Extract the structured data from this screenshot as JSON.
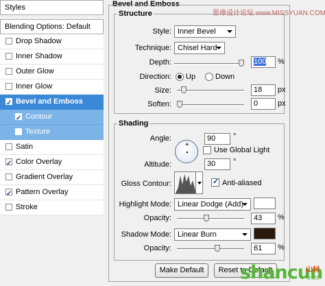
{
  "left_panel": {
    "header": "Styles",
    "blending": "Blending Options: Default",
    "items": [
      {
        "label": "Drop Shadow",
        "checked": false
      },
      {
        "label": "Inner Shadow",
        "checked": false
      },
      {
        "label": "Outer Glow",
        "checked": false
      },
      {
        "label": "Inner Glow",
        "checked": false
      },
      {
        "label": "Bevel and Emboss",
        "checked": true
      },
      {
        "label": "Contour",
        "checked": true
      },
      {
        "label": "Texture",
        "checked": false
      },
      {
        "label": "Satin",
        "checked": false
      },
      {
        "label": "Color Overlay",
        "checked": true
      },
      {
        "label": "Gradient Overlay",
        "checked": false
      },
      {
        "label": "Pattern Overlay",
        "checked": true
      },
      {
        "label": "Stroke",
        "checked": false
      }
    ]
  },
  "bevel": {
    "title": "Bevel and Emboss",
    "structure": {
      "title": "Structure",
      "style_label": "Style:",
      "style_value": "Inner Bevel",
      "technique_label": "Technique:",
      "technique_value": "Chisel Hard",
      "depth_label": "Depth:",
      "depth_value": "100",
      "depth_unit": "%",
      "depth_level": 1.0,
      "direction_label": "Direction:",
      "direction_up": "Up",
      "direction_down": "Down",
      "size_label": "Size:",
      "size_value": "18",
      "size_unit": "px",
      "size_level": 0.07,
      "soften_label": "Soften:",
      "soften_value": "0",
      "soften_unit": "px",
      "soften_level": 0.0
    },
    "shading": {
      "title": "Shading",
      "angle_label": "Angle:",
      "angle_value": "90",
      "angle_unit": "°",
      "global_light_label": "Use Global Light",
      "altitude_label": "Altitude:",
      "altitude_value": "30",
      "altitude_unit": "°",
      "gloss_label": "Gloss Contour:",
      "anti_aliased_label": "Anti-aliased",
      "highlight_label": "Highlight Mode:",
      "highlight_value": "Linear Dodge (Add)",
      "highlight_color": "#ffffff",
      "h_opacity_label": "Opacity:",
      "h_opacity_value": "43",
      "h_opacity_unit": "%",
      "h_opacity_level": 0.43,
      "shadow_label": "Shadow Mode:",
      "shadow_value": "Linear Burn",
      "shadow_color": "#2a1a0c",
      "s_opacity_label": "Opacity:",
      "s_opacity_value": "61",
      "s_opacity_unit": "%",
      "s_opacity_level": 0.61
    },
    "make_default": "Make Default",
    "reset_default": "Reset to Default"
  },
  "watermark": {
    "top": "思缘设计论坛 www.MISSYUAN.COM",
    "logo": "shancun",
    "logo_sub": ".net",
    "logo_cn": "山村"
  },
  "colors": {
    "selected": "#3a88d8",
    "sub_selected": "#7cb4e8"
  }
}
